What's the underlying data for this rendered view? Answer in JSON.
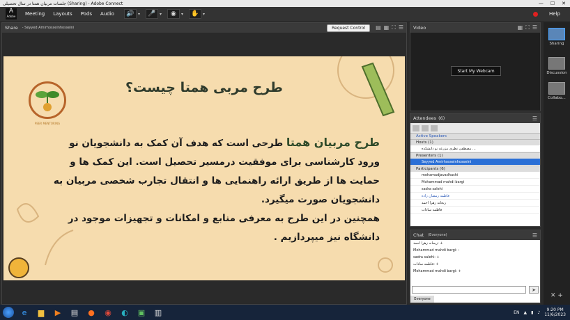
{
  "window": {
    "title": "جلسات مربیان همتا در سال تحصیلی (Sharing) - Adobe Connect"
  },
  "menubar": {
    "logo_letter": "A",
    "logo_sub": "Adobe",
    "items": [
      "Meeting",
      "Layouts",
      "Pods",
      "Audio"
    ],
    "help": "Help"
  },
  "share_pod": {
    "label": "Share",
    "presenter": "- Seyyed Amirhosseinhosseini",
    "request_control": "Request Control"
  },
  "slide": {
    "title": "طرح مربی همتا چیست؟",
    "body_emphasis": "طرح مربیان همتا",
    "body_line1": " طرحی است که هدف آن کمک به دانشجویان نو",
    "body_line2": "ورود کارشناسی برای موفقیت درمسیر تحصیل است. این کمک ها و",
    "body_line3": "حمایت ها از طریق ارائه راهنمایی ها و انتقال تجارب شخصی مربیان به",
    "body_line4": "دانشجویان صورت میگیرد.",
    "body_line5": "همچنین در این طرح به معرفی منابع و امکانات و تجهیزات موجود در",
    "body_line6": "دانشگاه نیز میپردازیم .",
    "logo_caption": "PEER MENTORING"
  },
  "video_pod": {
    "label": "Video",
    "start_webcam": "Start My Webcam"
  },
  "attendees": {
    "label": "Attendees",
    "count": "(6)",
    "active_speakers": "Active Speakers",
    "hosts_label": "Hosts (1)",
    "hosts": [
      "مصطفی نظری مزرعه نو دانشکده ..."
    ],
    "presenters_label": "Presenters (1)",
    "presenters": [
      "Seyyed Amirhosseinhosseini"
    ],
    "participants_label": "Participants (6)",
    "participants": [
      "mohamadjavadhashi",
      "Mohammad mahdi bargi",
      "sadra salehi",
      "فاطمه رمضان زاده",
      "ریحانه زهرا احمد",
      "فاطمه سادات"
    ]
  },
  "chat": {
    "label": "Chat",
    "scope": "(Everyone)",
    "messages": [
      "ریحانه زهرا احمد: +",
      "Mohammad mahdi bargi: :",
      "sadra salehi: +",
      "فاطمه سادات: +",
      "Mohammad mahdi bargi: +"
    ],
    "tab": "Everyone"
  },
  "rail": {
    "items": [
      "Sharing",
      "Discussion",
      "Collabo..."
    ]
  },
  "taskbar": {
    "lang": "EN",
    "time": "9:20 PM",
    "date": "11/6/2023"
  }
}
